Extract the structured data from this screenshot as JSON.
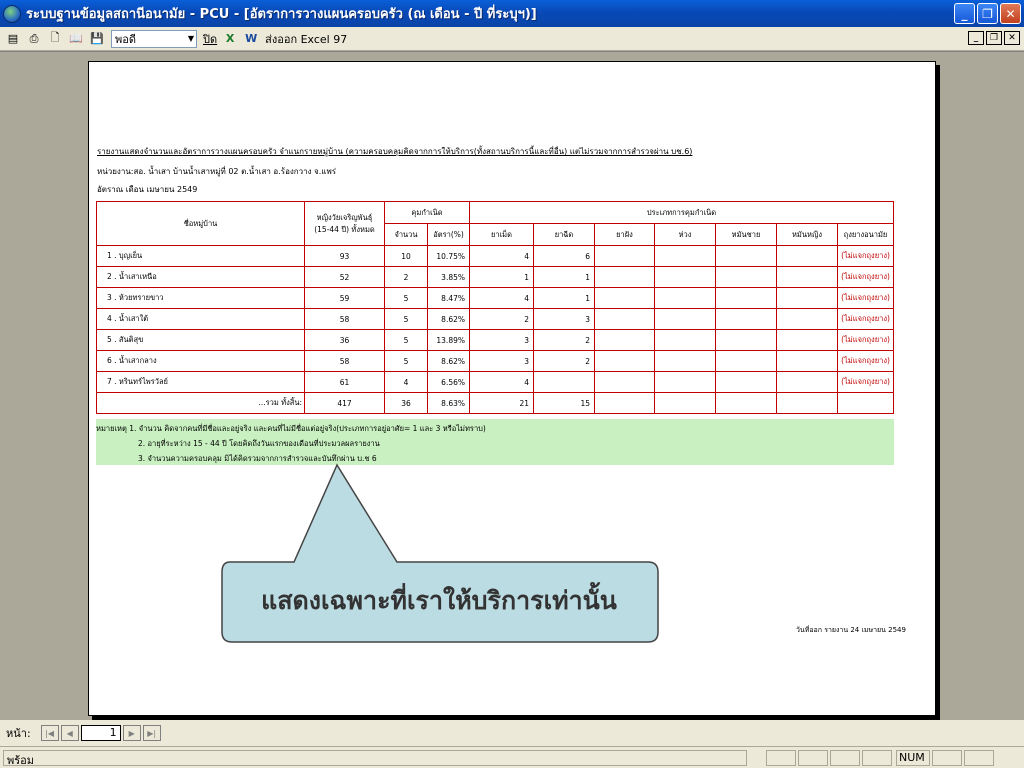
{
  "window": {
    "title": "ระบบฐานข้อมูลสถานีอนามัย - PCU - [อัตราการวางแผนครอบครัว (ณ เดือน - ปี ที่ระบุฯ)]"
  },
  "toolbar": {
    "zoom_value": "พอดี",
    "close_label": "ปิด",
    "export_label": "ส่งออก Excel 97"
  },
  "report": {
    "title": "รายงานแสดงจำนวนและอัตราการวางแผนครอบครัว จำแนกรายหมู่บ้าน (ความครอบคลุมคิดจากการให้บริการ(ทั้งสถานบริการนี้และที่อื่น) แต่ไม่รวมจากการสำรวจผ่าน บช.6)",
    "unit": "หน่วยงาน:สอ. น้ำเสา บ้านน้ำเสาหมู่ที่ 02  ต.น้ำเสา อ.ร้องกวาง จ.แพร่",
    "period": "อัตราณ เดือน เมษายน  2549",
    "headers": {
      "village": "ชื่อหมู่บ้าน",
      "women": "หญิงวัยเจริญพันธุ์",
      "women_sub": "(15-44 ปี) ทั้งหมด",
      "contraception": "คุมกำเนิด",
      "count": "จำนวน",
      "rate": "อัตรา(%)",
      "methods_group": "ประเภทการคุมกำเนิด",
      "methods": [
        "ยาเม็ด",
        "ยาฉีด",
        "ยาฝัง",
        "ห่วง",
        "หมันชาย",
        "หมันหญิง",
        "ถุงยางอนามัย"
      ]
    },
    "rows": [
      {
        "village": "1 . บุญเย็น",
        "women": "93",
        "count": "10",
        "rate": "10.75%",
        "pill": "4",
        "inj": "6",
        "implant": "",
        "iud": "",
        "male_ster": "",
        "female_ster": "",
        "condom": "(ไม่แจกถุงยาง)"
      },
      {
        "village": "2 . น้ำเสาเหนือ",
        "women": "52",
        "count": "2",
        "rate": "3.85%",
        "pill": "1",
        "inj": "1",
        "implant": "",
        "iud": "",
        "male_ster": "",
        "female_ster": "",
        "condom": "(ไม่แจกถุงยาง)"
      },
      {
        "village": "3 . ห้วยทรายขาว",
        "women": "59",
        "count": "5",
        "rate": "8.47%",
        "pill": "4",
        "inj": "1",
        "implant": "",
        "iud": "",
        "male_ster": "",
        "female_ster": "",
        "condom": "(ไม่แจกถุงยาง)"
      },
      {
        "village": "4 . น้ำเสาใต้",
        "women": "58",
        "count": "5",
        "rate": "8.62%",
        "pill": "2",
        "inj": "3",
        "implant": "",
        "iud": "",
        "male_ster": "",
        "female_ster": "",
        "condom": "(ไม่แจกถุงยาง)"
      },
      {
        "village": "5 . สันติสุข",
        "women": "36",
        "count": "5",
        "rate": "13.89%",
        "pill": "3",
        "inj": "2",
        "implant": "",
        "iud": "",
        "male_ster": "",
        "female_ster": "",
        "condom": "(ไม่แจกถุงยาง)"
      },
      {
        "village": "6 . น้ำเสากลาง",
        "women": "58",
        "count": "5",
        "rate": "8.62%",
        "pill": "3",
        "inj": "2",
        "implant": "",
        "iud": "",
        "male_ster": "",
        "female_ster": "",
        "condom": "(ไม่แจกถุงยาง)"
      },
      {
        "village": "7 . หรินทร์ไพรวัลย์",
        "women": "61",
        "count": "4",
        "rate": "6.56%",
        "pill": "4",
        "inj": "",
        "implant": "",
        "iud": "",
        "male_ster": "",
        "female_ster": "",
        "condom": "(ไม่แจกถุงยาง)"
      }
    ],
    "total": {
      "label": "...รวม ทั้งสิ้น:",
      "women": "417",
      "count": "36",
      "rate": "8.63%",
      "pill": "21",
      "inj": "15"
    },
    "notes": [
      "หมายเหตุ 1. จำนวน คิดจากคนที่มีชื่อและอยู่จริง และคนที่ไม่มีชื่อแต่อยู่จริง(ประเภทการอยู่อาศัย= 1 และ 3 หรือไม่ทราบ)",
      "2. อายุที่ระหว่าง 15 - 44 ปี โดยคิดถึงวันแรกของเดือนที่ประมวลผลรายงาน",
      "3. จำนวนความครอบคลุม มิได้คิดรวมจากการสำรวจและบันทึกผ่าน บ.ช 6"
    ],
    "print_date": "วันที่ออก รายงาน 24 เมษายน 2549"
  },
  "callout": {
    "text": "แสดงเฉพาะที่เราให้บริการเท่านั้น"
  },
  "nav": {
    "label": "หน้า:",
    "page": "1"
  },
  "status": {
    "text": "พร้อม",
    "num": "NUM"
  }
}
